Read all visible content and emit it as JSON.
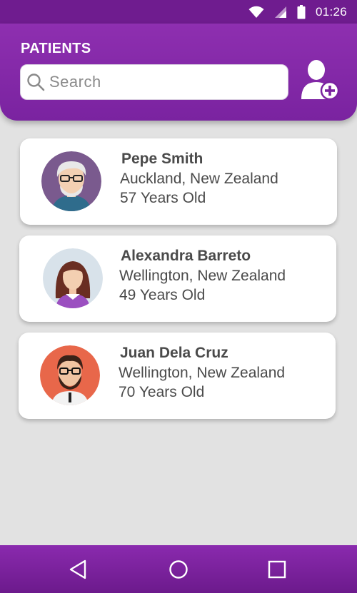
{
  "status_bar": {
    "time": "01:26",
    "icons": [
      "wifi-icon",
      "signal-icon",
      "battery-icon"
    ]
  },
  "header": {
    "title": "PATIENTS",
    "search_placeholder": "Search",
    "add_patient_icon": "add-user-icon"
  },
  "patients": [
    {
      "name": "Pepe Smith",
      "location": "Auckland, New Zealand",
      "age": "57 Years Old",
      "avatar_bg": "#7a5a8e"
    },
    {
      "name": "Alexandra Barreto",
      "location": "Wellington, New Zealand",
      "age": "49 Years Old",
      "avatar_bg": "#d8e2ea"
    },
    {
      "name": "Juan Dela Cruz",
      "location": "Wellington, New Zealand",
      "age": "70 Years Old",
      "avatar_bg": "#e8674a"
    }
  ],
  "nav_bar": {
    "buttons": [
      "back-icon",
      "home-icon",
      "recents-icon"
    ]
  },
  "colors": {
    "brand": "#8e2fb0",
    "status_bar": "#6f1c8f",
    "background": "#e2e2e2"
  }
}
